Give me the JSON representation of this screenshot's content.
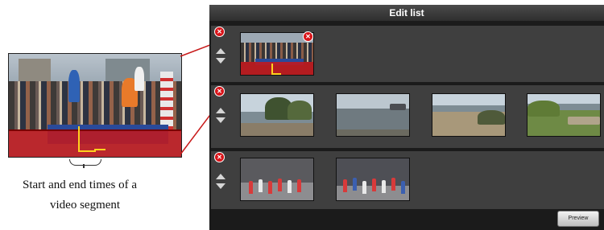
{
  "window": {
    "title": "Edit list"
  },
  "annotation": {
    "caption_line1": "Start and end times of a",
    "caption_line2": "video segment"
  },
  "segments": [
    {
      "clips": [
        {
          "scene": "parade-with-red-overlay",
          "removable": true
        }
      ]
    },
    {
      "clips": [
        {
          "scene": "beach-shoreline"
        },
        {
          "scene": "calm-sea-pier"
        },
        {
          "scene": "sandy-cove"
        },
        {
          "scene": "grassy-path-coast"
        }
      ]
    },
    {
      "clips": [
        {
          "scene": "dancers-street"
        },
        {
          "scene": "dancers-crowd"
        }
      ]
    }
  ],
  "controls": {
    "delete_glyph": "✕",
    "preview_label": "Preview"
  },
  "colors": {
    "panel_background": "#1b1b1b",
    "segment_background": "#3f3f3f",
    "delete_red": "#d9151a",
    "segment_highlight": "#c4181c",
    "time_marker": "#ffd21e"
  }
}
